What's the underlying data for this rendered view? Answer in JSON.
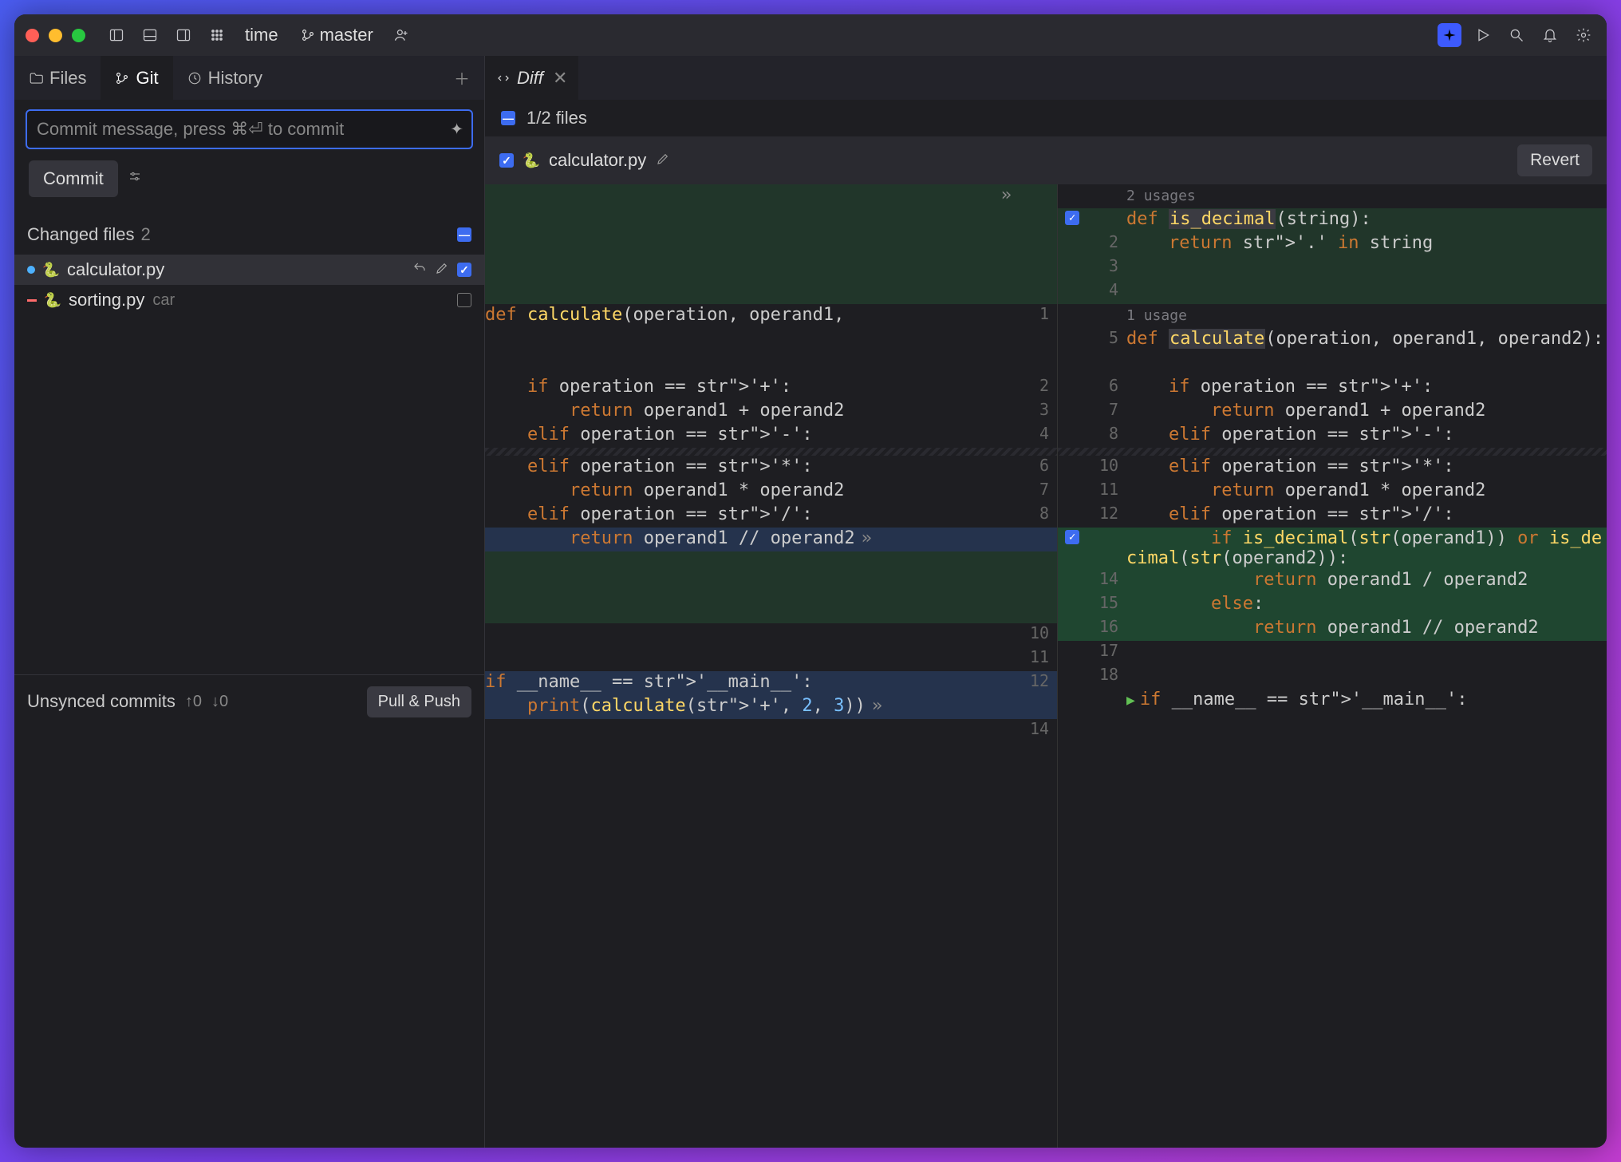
{
  "window": {
    "project": "time",
    "branch": "master"
  },
  "titlebar_icons": [
    "panel-left",
    "panel-bottom",
    "panel-right",
    "grid"
  ],
  "sidebar": {
    "tabs": [
      {
        "id": "files",
        "label": "Files",
        "icon": "folder"
      },
      {
        "id": "git",
        "label": "Git",
        "icon": "branch",
        "active": true
      },
      {
        "id": "history",
        "label": "History",
        "icon": "clock"
      }
    ],
    "commit_placeholder": "Commit message, press ⌘⏎ to commit",
    "commit_button": "Commit",
    "changed_header": "Changed files",
    "changed_count": "2",
    "files": [
      {
        "name": "calculator.py",
        "status": "modified",
        "checked": true,
        "active": true,
        "annot": ""
      },
      {
        "name": "sorting.py",
        "status": "deleted",
        "checked": false,
        "annot": "car"
      }
    ],
    "unsynced_label": "Unsynced commits",
    "unsynced_up": "↑0",
    "unsynced_down": "↓0",
    "pull_push": "Pull & Push"
  },
  "diff": {
    "tab_label": "Diff",
    "files_progress": "1/2 files",
    "active_file": "calculator.py",
    "revert": "Revert",
    "left_usage": "",
    "right_usage_top": "2 usages",
    "right_usage_calc": "1 usage",
    "left_lines": [
      {
        "n": "",
        "txt": "",
        "cls": "add"
      },
      {
        "n": "",
        "txt": "",
        "cls": "add"
      },
      {
        "n": "",
        "txt": "",
        "cls": "add"
      },
      {
        "n": "",
        "txt": "",
        "cls": "add"
      },
      {
        "n": "1",
        "txt": "def calculate(operation, operand1,",
        "cls": "",
        "sig": true
      },
      {
        "n": "",
        "txt": "",
        "cls": ""
      },
      {
        "n": "",
        "txt": "",
        "cls": ""
      },
      {
        "n": "2",
        "txt": "    if operation == '+':",
        "cls": ""
      },
      {
        "n": "3",
        "txt": "        return operand1 + operand2",
        "cls": ""
      },
      {
        "n": "4",
        "txt": "    elif operation == '-':",
        "cls": ""
      },
      {
        "wave": true
      },
      {
        "n": "6",
        "txt": "    elif operation == '*':",
        "cls": ""
      },
      {
        "n": "7",
        "txt": "        return operand1 * operand2",
        "cls": ""
      },
      {
        "n": "8",
        "txt": "    elif operation == '/':",
        "cls": ""
      },
      {
        "n": "",
        "txt": "        return operand1 // operand2",
        "cls": "changed",
        "fold": true
      },
      {
        "n": "",
        "txt": "",
        "cls": "add"
      },
      {
        "n": "",
        "txt": "",
        "cls": "add"
      },
      {
        "n": "",
        "txt": "",
        "cls": "add"
      },
      {
        "n": "10",
        "txt": "",
        "cls": ""
      },
      {
        "n": "11",
        "txt": "",
        "cls": ""
      },
      {
        "n": "12",
        "txt": "if __name__ == '__main__':",
        "cls": "changed"
      },
      {
        "n": "",
        "txt": "    print(calculate('+', 2, 3))",
        "cls": "changed",
        "fold": true
      },
      {
        "n": "14",
        "txt": "",
        "cls": ""
      }
    ],
    "right_lines": [
      {
        "usage": "2 usages"
      },
      {
        "n": "",
        "txt": "def is_decimal(string):",
        "cls": "add",
        "chk": true,
        "sig": true,
        "fn": "is_decimal"
      },
      {
        "n": "2",
        "txt": "    return '.' in string",
        "cls": "add"
      },
      {
        "n": "3",
        "txt": "",
        "cls": "add"
      },
      {
        "n": "4",
        "txt": "",
        "cls": "add"
      },
      {
        "usage": "1 usage"
      },
      {
        "n": "5",
        "txt": "def calculate(operation, operand1, operand2):",
        "cls": "",
        "sig": true,
        "fn": "calculate",
        "wrap": true
      },
      {
        "n": "",
        "txt": "",
        "cls": ""
      },
      {
        "n": "6",
        "txt": "    if operation == '+':",
        "cls": ""
      },
      {
        "n": "7",
        "txt": "        return operand1 + operand2",
        "cls": ""
      },
      {
        "n": "8",
        "txt": "    elif operation == '-':",
        "cls": ""
      },
      {
        "wave": true
      },
      {
        "n": "10",
        "txt": "    elif operation == '*':",
        "cls": ""
      },
      {
        "n": "11",
        "txt": "        return operand1 * operand2",
        "cls": ""
      },
      {
        "n": "12",
        "txt": "    elif operation == '/':",
        "cls": ""
      },
      {
        "n": "",
        "txt": "        if is_decimal(str(operand1)) or is_decimal(str(operand2)):",
        "cls": "addstrong",
        "chk": true,
        "wrap": true
      },
      {
        "n": "14",
        "txt": "            return operand1 / operand2",
        "cls": "addstrong",
        "wrap": true
      },
      {
        "n": "15",
        "txt": "        else:",
        "cls": "addstrong"
      },
      {
        "n": "16",
        "txt": "            return operand1 // operand2",
        "cls": "addstrong",
        "wrap": true
      },
      {
        "n": "17",
        "txt": "",
        "cls": ""
      },
      {
        "n": "18",
        "txt": "",
        "cls": ""
      },
      {
        "n": "",
        "txt": "if __name__ == '__main__':",
        "cls": "",
        "play": true
      }
    ]
  },
  "colors": {
    "accent": "#3d6cf0",
    "add": "#21362a",
    "addstrong": "#1f4630",
    "changed": "#25334d"
  }
}
